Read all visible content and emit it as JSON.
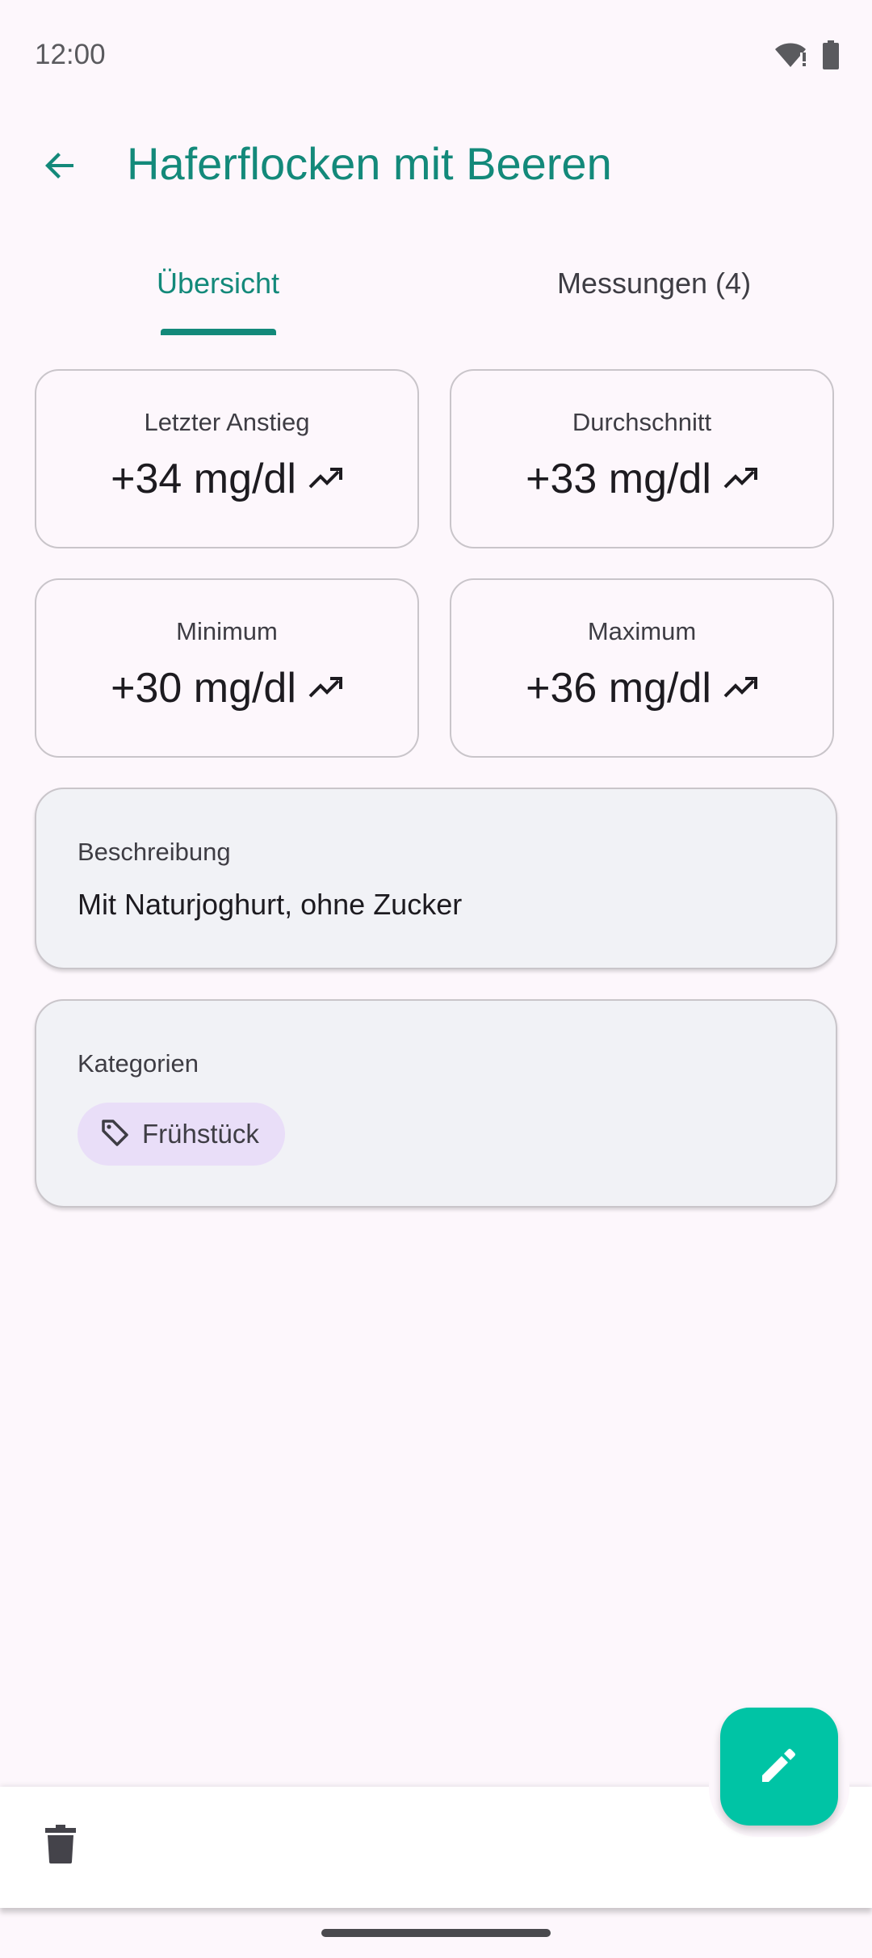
{
  "status_bar": {
    "time": "12:00"
  },
  "app_bar": {
    "title": "Haferflocken mit Beeren"
  },
  "tabs": [
    {
      "label": "Übersicht",
      "selected": true
    },
    {
      "label": "Messungen (4)",
      "selected": false
    }
  ],
  "stats": [
    {
      "label": "Letzter Anstieg",
      "value": "+34 mg/dl"
    },
    {
      "label": "Durchschnitt",
      "value": "+33 mg/dl"
    },
    {
      "label": "Minimum",
      "value": "+30 mg/dl"
    },
    {
      "label": "Maximum",
      "value": "+36 mg/dl"
    }
  ],
  "description": {
    "label": "Beschreibung",
    "text": "Mit Naturjoghurt, ohne Zucker"
  },
  "categories": {
    "label": "Kategorien",
    "chips": [
      {
        "label": "Frühstück"
      }
    ]
  },
  "colors": {
    "primary": "#13897a",
    "fab": "#00c4a5",
    "chip": "#e9def8",
    "card": "#f1f2f6"
  },
  "icons": {
    "back": "arrow-back-icon",
    "trend": "trending-up-icon",
    "tag": "tag-icon",
    "delete": "trash-icon",
    "edit": "pencil-icon",
    "wifi": "wifi-icon",
    "battery": "battery-icon"
  }
}
